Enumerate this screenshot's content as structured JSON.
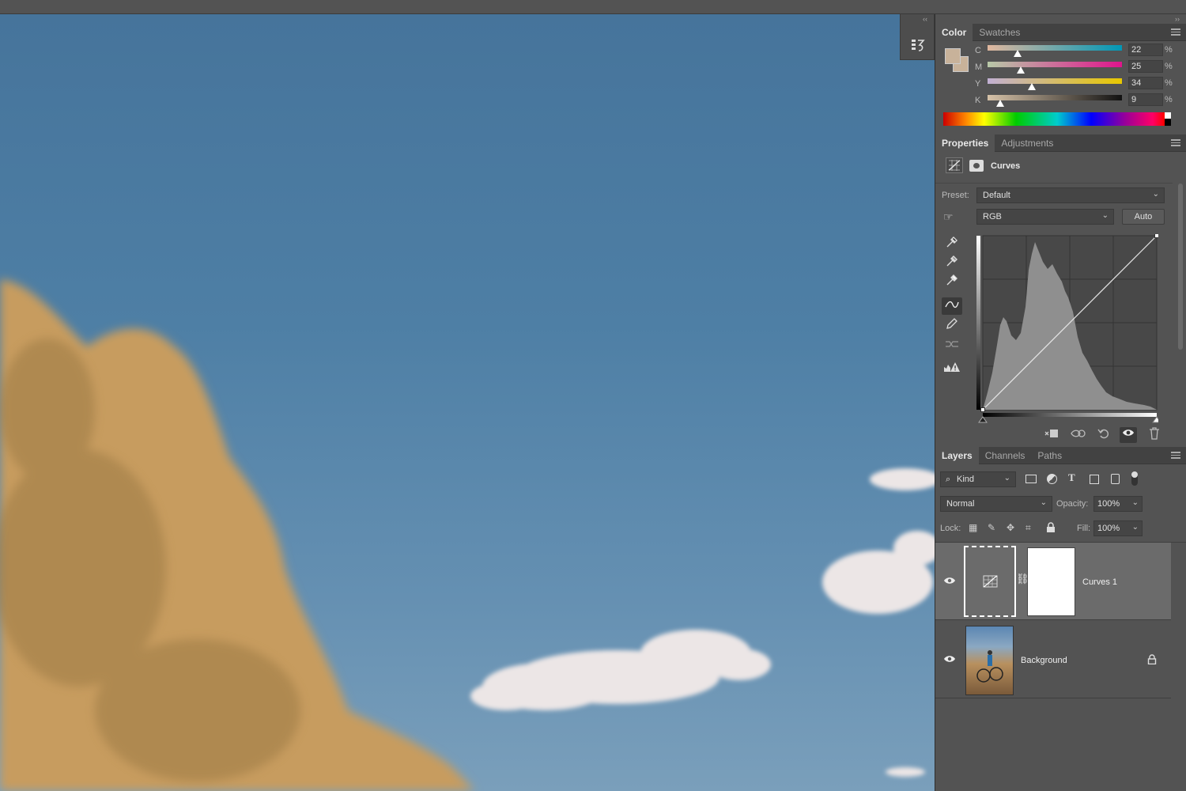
{
  "colors": {
    "accent_fg_swatch": "#c8b29a",
    "sky": "#4e7fa5",
    "tree": "#c79c5e"
  },
  "icons": {
    "history": "history-icon",
    "eye": "eye-icon",
    "lock": "lock-icon",
    "link": "chain-link-icon",
    "menu": "panel-menu-icon"
  },
  "color_panel": {
    "tabs": [
      "Color",
      "Swatches"
    ],
    "active_tab": "Color",
    "channels": [
      {
        "label": "C",
        "value": "22",
        "unit": "%"
      },
      {
        "label": "M",
        "value": "25",
        "unit": "%"
      },
      {
        "label": "Y",
        "value": "34",
        "unit": "%"
      },
      {
        "label": "K",
        "value": "9",
        "unit": "%"
      }
    ]
  },
  "properties_panel": {
    "tabs": [
      "Properties",
      "Adjustments"
    ],
    "active_tab": "Properties",
    "title": "Curves",
    "preset_label": "Preset:",
    "preset_value": "Default",
    "channel_value": "RGB",
    "auto_label": "Auto"
  },
  "layers_panel": {
    "tabs": [
      "Layers",
      "Channels",
      "Paths"
    ],
    "active_tab": "Layers",
    "filter_value": "Kind",
    "blend_mode": "Normal",
    "opacity_label": "Opacity:",
    "opacity_value": "100%",
    "lock_label": "Lock:",
    "fill_label": "Fill:",
    "fill_value": "100%",
    "layers": [
      {
        "name": "Curves 1",
        "selected": true,
        "visible": true
      },
      {
        "name": "Background",
        "selected": false,
        "visible": true,
        "locked": true
      }
    ]
  }
}
